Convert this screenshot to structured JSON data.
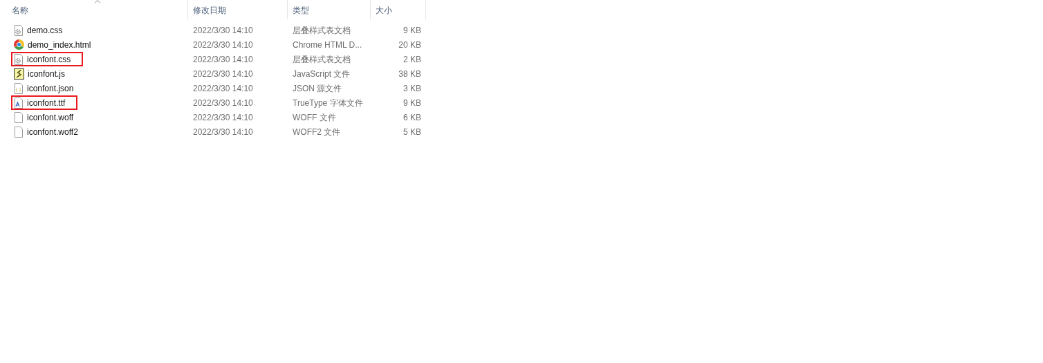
{
  "columns": [
    {
      "label": "名称",
      "sorted": true
    },
    {
      "label": "修改日期",
      "sorted": false
    },
    {
      "label": "类型",
      "sorted": false
    },
    {
      "label": "大小",
      "sorted": false
    }
  ],
  "files": [
    {
      "name": "demo.css",
      "date": "2022/3/30 14:10",
      "type": "层叠样式表文档",
      "size": "9 KB",
      "kind": "css",
      "highlighted": false
    },
    {
      "name": "demo_index.html",
      "date": "2022/3/30 14:10",
      "type": "Chrome HTML D...",
      "size": "20 KB",
      "kind": "chrome",
      "highlighted": false
    },
    {
      "name": "iconfont.css",
      "date": "2022/3/30 14:10",
      "type": "层叠样式表文档",
      "size": "2 KB",
      "kind": "css",
      "highlighted": true
    },
    {
      "name": "iconfont.js",
      "date": "2022/3/30 14:10",
      "type": "JavaScript 文件",
      "size": "38 KB",
      "kind": "js",
      "highlighted": false
    },
    {
      "name": "iconfont.json",
      "date": "2022/3/30 14:10",
      "type": "JSON 源文件",
      "size": "3 KB",
      "kind": "json",
      "highlighted": false
    },
    {
      "name": "iconfont.ttf",
      "date": "2022/3/30 14:10",
      "type": "TrueType 字体文件",
      "size": "9 KB",
      "kind": "ttf",
      "highlighted": true
    },
    {
      "name": "iconfont.woff",
      "date": "2022/3/30 14:10",
      "type": "WOFF 文件",
      "size": "6 KB",
      "kind": "file",
      "highlighted": false
    },
    {
      "name": "iconfont.woff2",
      "date": "2022/3/30 14:10",
      "type": "WOFF2 文件",
      "size": "5 KB",
      "kind": "file",
      "highlighted": false
    }
  ]
}
